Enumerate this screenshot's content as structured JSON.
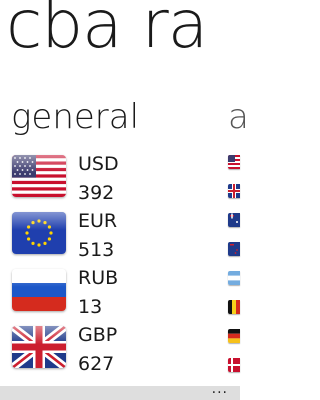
{
  "app_title": "cba ra",
  "pivots": [
    "general",
    "a"
  ],
  "rates": [
    {
      "code": "USD",
      "value": "392",
      "flag": "us-flag-icon"
    },
    {
      "code": "EUR",
      "value": "513",
      "flag": "eu-flag-icon"
    },
    {
      "code": "RUB",
      "value": "13",
      "flag": "ru-flag-icon"
    },
    {
      "code": "GBP",
      "value": "627",
      "flag": "gb-flag-icon"
    }
  ],
  "app_bar": {
    "more_label": "..."
  }
}
